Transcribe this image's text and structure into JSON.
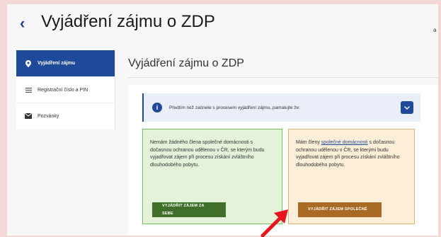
{
  "header": {
    "back_icon": "chevron-left-icon",
    "title": "Vyjádření zájmu o ZDP",
    "corner_letter": "a"
  },
  "sidebar": {
    "items": [
      {
        "icon": "map-pin-icon",
        "label": "Vyjádření zájmu",
        "active": true
      },
      {
        "icon": "list-icon",
        "label": "Registrační číslo a PIN",
        "active": false
      },
      {
        "icon": "envelope-icon",
        "label": "Pozvánky",
        "active": false
      }
    ]
  },
  "main": {
    "section_title": "Vyjádření zájmu o ZDP",
    "info": {
      "text": "Předtím než začnete s procesem vyjádření zájmu, pamatujte že:"
    },
    "option_alone": {
      "text": "Nemám žádného člena společné domácnosti s dočasnou ochranou udělenou v ČR, se kterým budu vyjadřovat zájem při procesu získání zvláštního dlouhodobého pobytu.",
      "button_label": "VYJÁDŘIT ZÁJEM ZA SEBE"
    },
    "option_together": {
      "text_before_link": "Mám členy ",
      "link_text": "společné domácnosti",
      "text_after_link": " s dočasnou ochranou udělenou v ČR, se kterými budu vyjadřovat zájem při procesu získání zvláštního dlouhodobého pobytu.",
      "button_label": "VYJÁDŘIT ZÁJEM SPOLEČNĚ"
    }
  },
  "colors": {
    "primary": "#1f4a9a",
    "green_bg": "#e4f2da",
    "green_button": "#3f6f2a",
    "orange_bg": "#fdeed8",
    "orange_button": "#a86a24",
    "annotation_arrow": "#e8141c"
  }
}
